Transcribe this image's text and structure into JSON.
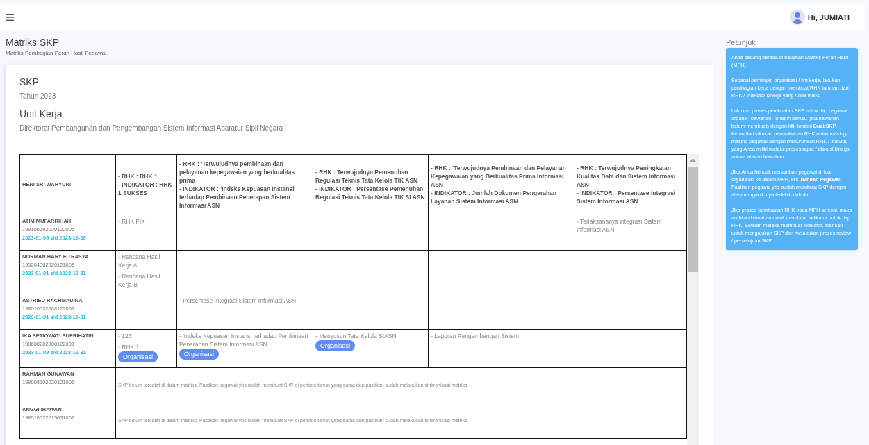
{
  "topbar": {
    "greeting": "Hi, JUMIATI"
  },
  "page": {
    "title": "Matriks SKP",
    "subtitle": "Matriks Pembagian Peran Hasil Pegawai."
  },
  "card": {
    "title": "SKP",
    "year": "Tahun 2023",
    "unit_label": "Unit Kerja",
    "unit": "Direktorat Pembangunan dan Pengembangan Sistem Informasi Aparatur Sipil Negara"
  },
  "table": {
    "head_name": "HENI SRI WAHYUNI",
    "columns": [
      {
        "lines": [
          "- RHK : RHK 1",
          "- INDIKATOR : RHK 1 SUKSES"
        ]
      },
      {
        "lines": [
          "- RHK : 'Terwujudnya pembinaan dan pelayanan kepegawaian yang berkualitas prima",
          "- INDIKATOR : 'Indeks Kepuasan Instansi terhadap Pembinaan Penerapan Sistem Informasi ASN"
        ]
      },
      {
        "lines": [
          "- RHK : Terwujudnya Pemenuhan Regulasi Teknis Tata Kelola TIK ASN",
          "- INDIKATOR : Persentase Pemenuhan Regulasi Teknis Tata Kelola TIK SI ASN"
        ]
      },
      {
        "lines": [
          "- RHK : 'Terwujudnya Pembinaan dan Pelayanan Kepegawaian yang Berkualitas Prima Informasi ASN",
          "- INDIKATOR : Jumlah Dokumen Pengarahan Layanan Sistem Informasi ASN"
        ]
      },
      {
        "lines": [
          "- RHK : Terwujudnya Peningkatan Kualitas Data dan Sistem Informasi ASN",
          "- INDIKATOR : Persentase Integrasi Sistem Informasi ASN"
        ]
      }
    ],
    "rows": [
      {
        "kind": "matrix",
        "name": "ATIM MUFARRIHAH",
        "nip": "199106192020122005",
        "period": "2023-01-09 s/d 2023-12-09",
        "cells": [
          [
            {
              "text": "- RHK FIX"
            }
          ],
          [],
          [],
          [],
          [
            {
              "text": "- Terlaksananya integrasi Sistem Informasi ASN"
            }
          ]
        ]
      },
      {
        "kind": "matrix",
        "name": "NORMAN HARY FITRASYA",
        "nip": "199204082020121005",
        "period": "2023-01-01 s/d 2023-12-31",
        "cells": [
          [
            {
              "text": "- Rencana Hasil Kerja A"
            },
            {
              "text": "- Rencana Hasil Kerja B"
            }
          ],
          [],
          [],
          [],
          []
        ]
      },
      {
        "kind": "matrix",
        "name": "ASTRIED RACHMADINA",
        "nip": "198510032008122001",
        "period": "2023-01-01 s/d 2023-12-31",
        "cells": [
          [],
          [
            {
              "text": "- Persentase Integrasi Sistem Informasi ASN"
            }
          ],
          [],
          [],
          []
        ]
      },
      {
        "kind": "matrix",
        "name": "IKA SETIOWATI SUPRIHATIN",
        "nip": "198608202008122001",
        "period": "2023-01-09 s/d 2023-12-31",
        "cells": [
          [
            {
              "text": "- 123"
            },
            {
              "text": "- RHK 1",
              "tag": "Organisasi"
            }
          ],
          [
            {
              "text": "- 'Indeks Kepuasan Instansi terhadap Pembinaan Penerapan Sistem Informasi ASN",
              "tag": "Organisasi"
            }
          ],
          [
            {
              "text": "- Menyusun Tata Kelola SIASN",
              "tag": "Organisasi"
            }
          ],
          [
            {
              "text": "- Laporan Pengembangan Sistem"
            }
          ],
          []
        ]
      },
      {
        "kind": "note",
        "name": "RAHMAN GUNAWAN",
        "nip": "199008102020121006",
        "message": "SKP belum tercatat di dalam matriks. Pastikan pegawai ybs sudah membuat SKP di periode tahun yang sama dan pastikan sudah melakukan sinkronisasi matriks"
      },
      {
        "kind": "note",
        "name": "ANGGI IRAWAN",
        "nip": "198510022015031002",
        "message": "SKP belum tercatat di dalam matriks. Pastikan pegawai ybs sudah membuat SKP di periode tahun yang sama dan pastikan sudah melakukan sinkronisasi matriks"
      }
    ]
  },
  "help": {
    "title": "Petunjuk",
    "paragraphs": [
      "Anda sedang berada di halaman Matriks Peran Hasil (MPH).",
      "Sebagai pemimpin organisasi / tim kerja, lakukan pembagian kerja dengan membuat RHK turunan dari RHK / Indikator kinerja yang Anda miliki.",
      "Lakukan proses pembuatan SKP untuk tiap pegawai organik (bawahan) terlebih dahulu (jika bawahan belum membuat) dengan klik tombol **Buat SKP**. Kemudian lakukan penambahan RHK untuk masing-masing pegawai dengan menurunkan RHK / individu yang Anda miliki melalui proses rapat / diskusi kinerja antara atasan bawahan.",
      "Jika Anda hendak menambah pegawai di luar organisasi ke dalam MPH, klik **Tambah Pegawai**. Pastikan pegawai ybs sudah membuat SKP dengan atasan organik-nya terlebih dahulu.",
      "Jika proses pembuatan RHK pada MPH selesai, maka arahkan bawahan untuk membuat indikator untuk tiap RHK. Setelah mereka membuat indikator, arahkan untuk mengajukan SKP dan melakukan proses review / persetujuan SKP."
    ]
  }
}
